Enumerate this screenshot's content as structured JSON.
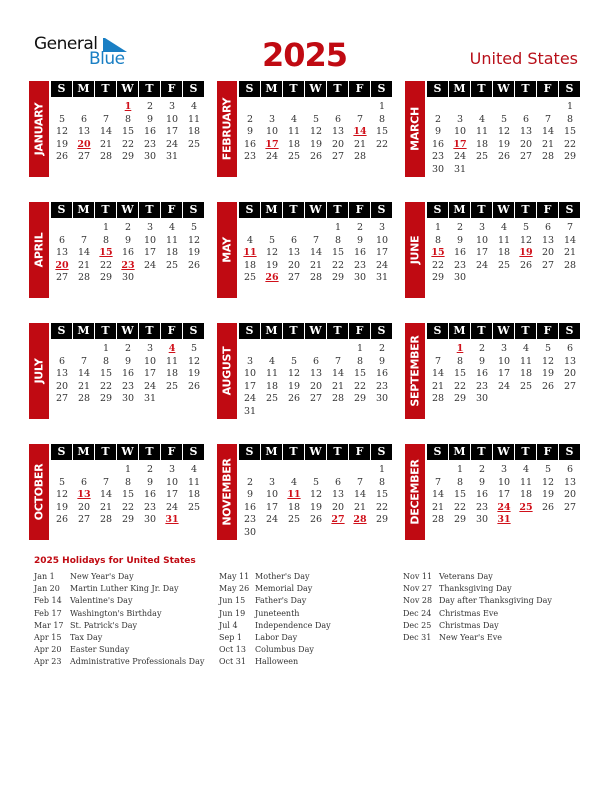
{
  "header": {
    "logo_general": "General",
    "logo_blue": "Blue",
    "year": "2025",
    "country": "United States"
  },
  "weekday_headers": [
    "S",
    "M",
    "T",
    "W",
    "T",
    "F",
    "S"
  ],
  "months": [
    {
      "name": "JANUARY",
      "start": 3,
      "days": 31,
      "holidays": [
        1,
        20
      ]
    },
    {
      "name": "FEBRUARY",
      "start": 6,
      "days": 28,
      "holidays": [
        14,
        17
      ]
    },
    {
      "name": "MARCH",
      "start": 6,
      "days": 31,
      "holidays": [
        17
      ]
    },
    {
      "name": "APRIL",
      "start": 2,
      "days": 30,
      "holidays": [
        15,
        20,
        23
      ]
    },
    {
      "name": "MAY",
      "start": 4,
      "days": 31,
      "holidays": [
        11,
        26
      ]
    },
    {
      "name": "JUNE",
      "start": 0,
      "days": 30,
      "holidays": [
        15,
        19
      ]
    },
    {
      "name": "JULY",
      "start": 2,
      "days": 31,
      "holidays": [
        4
      ]
    },
    {
      "name": "AUGUST",
      "start": 5,
      "days": 31,
      "holidays": []
    },
    {
      "name": "SEPTEMBER",
      "start": 1,
      "days": 30,
      "holidays": [
        1
      ]
    },
    {
      "name": "OCTOBER",
      "start": 3,
      "days": 31,
      "holidays": [
        13,
        31
      ]
    },
    {
      "name": "NOVEMBER",
      "start": 6,
      "days": 30,
      "holidays": [
        11,
        27,
        28
      ]
    },
    {
      "name": "DECEMBER",
      "start": 1,
      "days": 31,
      "holidays": [
        24,
        25,
        31
      ]
    }
  ],
  "holidays_title": "2025 Holidays for United States",
  "holidays": [
    [
      {
        "date": "Jan 1",
        "name": "New Year's Day"
      },
      {
        "date": "Jan 20",
        "name": "Martin Luther King Jr. Day"
      },
      {
        "date": "Feb 14",
        "name": "Valentine's Day"
      },
      {
        "date": "Feb 17",
        "name": "Washington's Birthday"
      },
      {
        "date": "Mar 17",
        "name": "St. Patrick's Day"
      },
      {
        "date": "Apr 15",
        "name": "Tax Day"
      },
      {
        "date": "Apr 20",
        "name": "Easter Sunday"
      },
      {
        "date": "Apr 23",
        "name": "Administrative Professionals Day"
      }
    ],
    [
      {
        "date": "May 11",
        "name": "Mother's Day"
      },
      {
        "date": "May 26",
        "name": "Memorial Day"
      },
      {
        "date": "Jun 15",
        "name": "Father's Day"
      },
      {
        "date": "Jun 19",
        "name": "Juneteenth"
      },
      {
        "date": "Jul 4",
        "name": "Independence Day"
      },
      {
        "date": "Sep 1",
        "name": "Labor Day"
      },
      {
        "date": "Oct 13",
        "name": "Columbus Day"
      },
      {
        "date": "Oct 31",
        "name": "Halloween"
      }
    ],
    [
      {
        "date": "Nov 11",
        "name": "Veterans Day"
      },
      {
        "date": "Nov 27",
        "name": "Thanksgiving Day"
      },
      {
        "date": "Nov 28",
        "name": "Day after Thanksgiving Day"
      },
      {
        "date": "Dec 24",
        "name": "Christmas Eve"
      },
      {
        "date": "Dec 25",
        "name": "Christmas Day"
      },
      {
        "date": "Dec 31",
        "name": "New Year's Eve"
      }
    ]
  ]
}
